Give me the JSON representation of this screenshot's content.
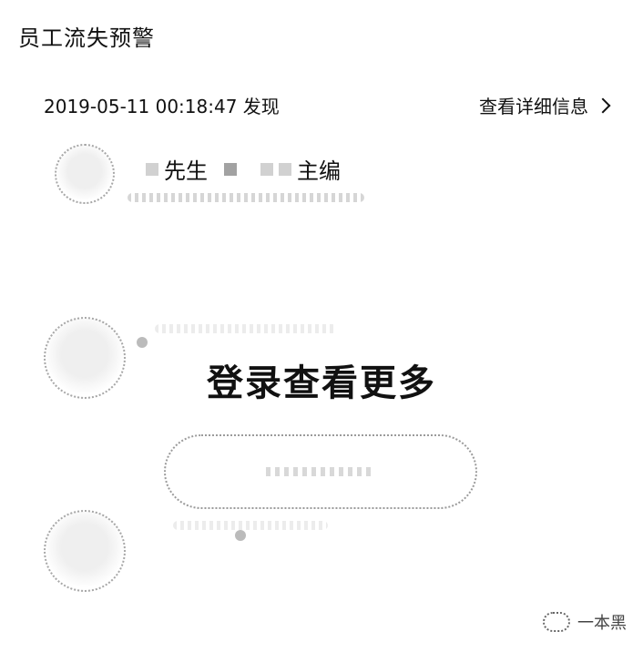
{
  "header": {
    "title": "员工流失预警"
  },
  "alert": {
    "datetime_text": "2019-05-11 00:18:47 发现",
    "details_link": "查看详细信息"
  },
  "profile": {
    "name_prefix": "先生",
    "title": "主编"
  },
  "login_prompt": {
    "text": "登录查看更多"
  },
  "watermark": {
    "text": "一本黑"
  },
  "icons": {
    "chevron": "chevron-right-icon",
    "avatar": "avatar-icon",
    "watermark": "wechat-icon"
  }
}
